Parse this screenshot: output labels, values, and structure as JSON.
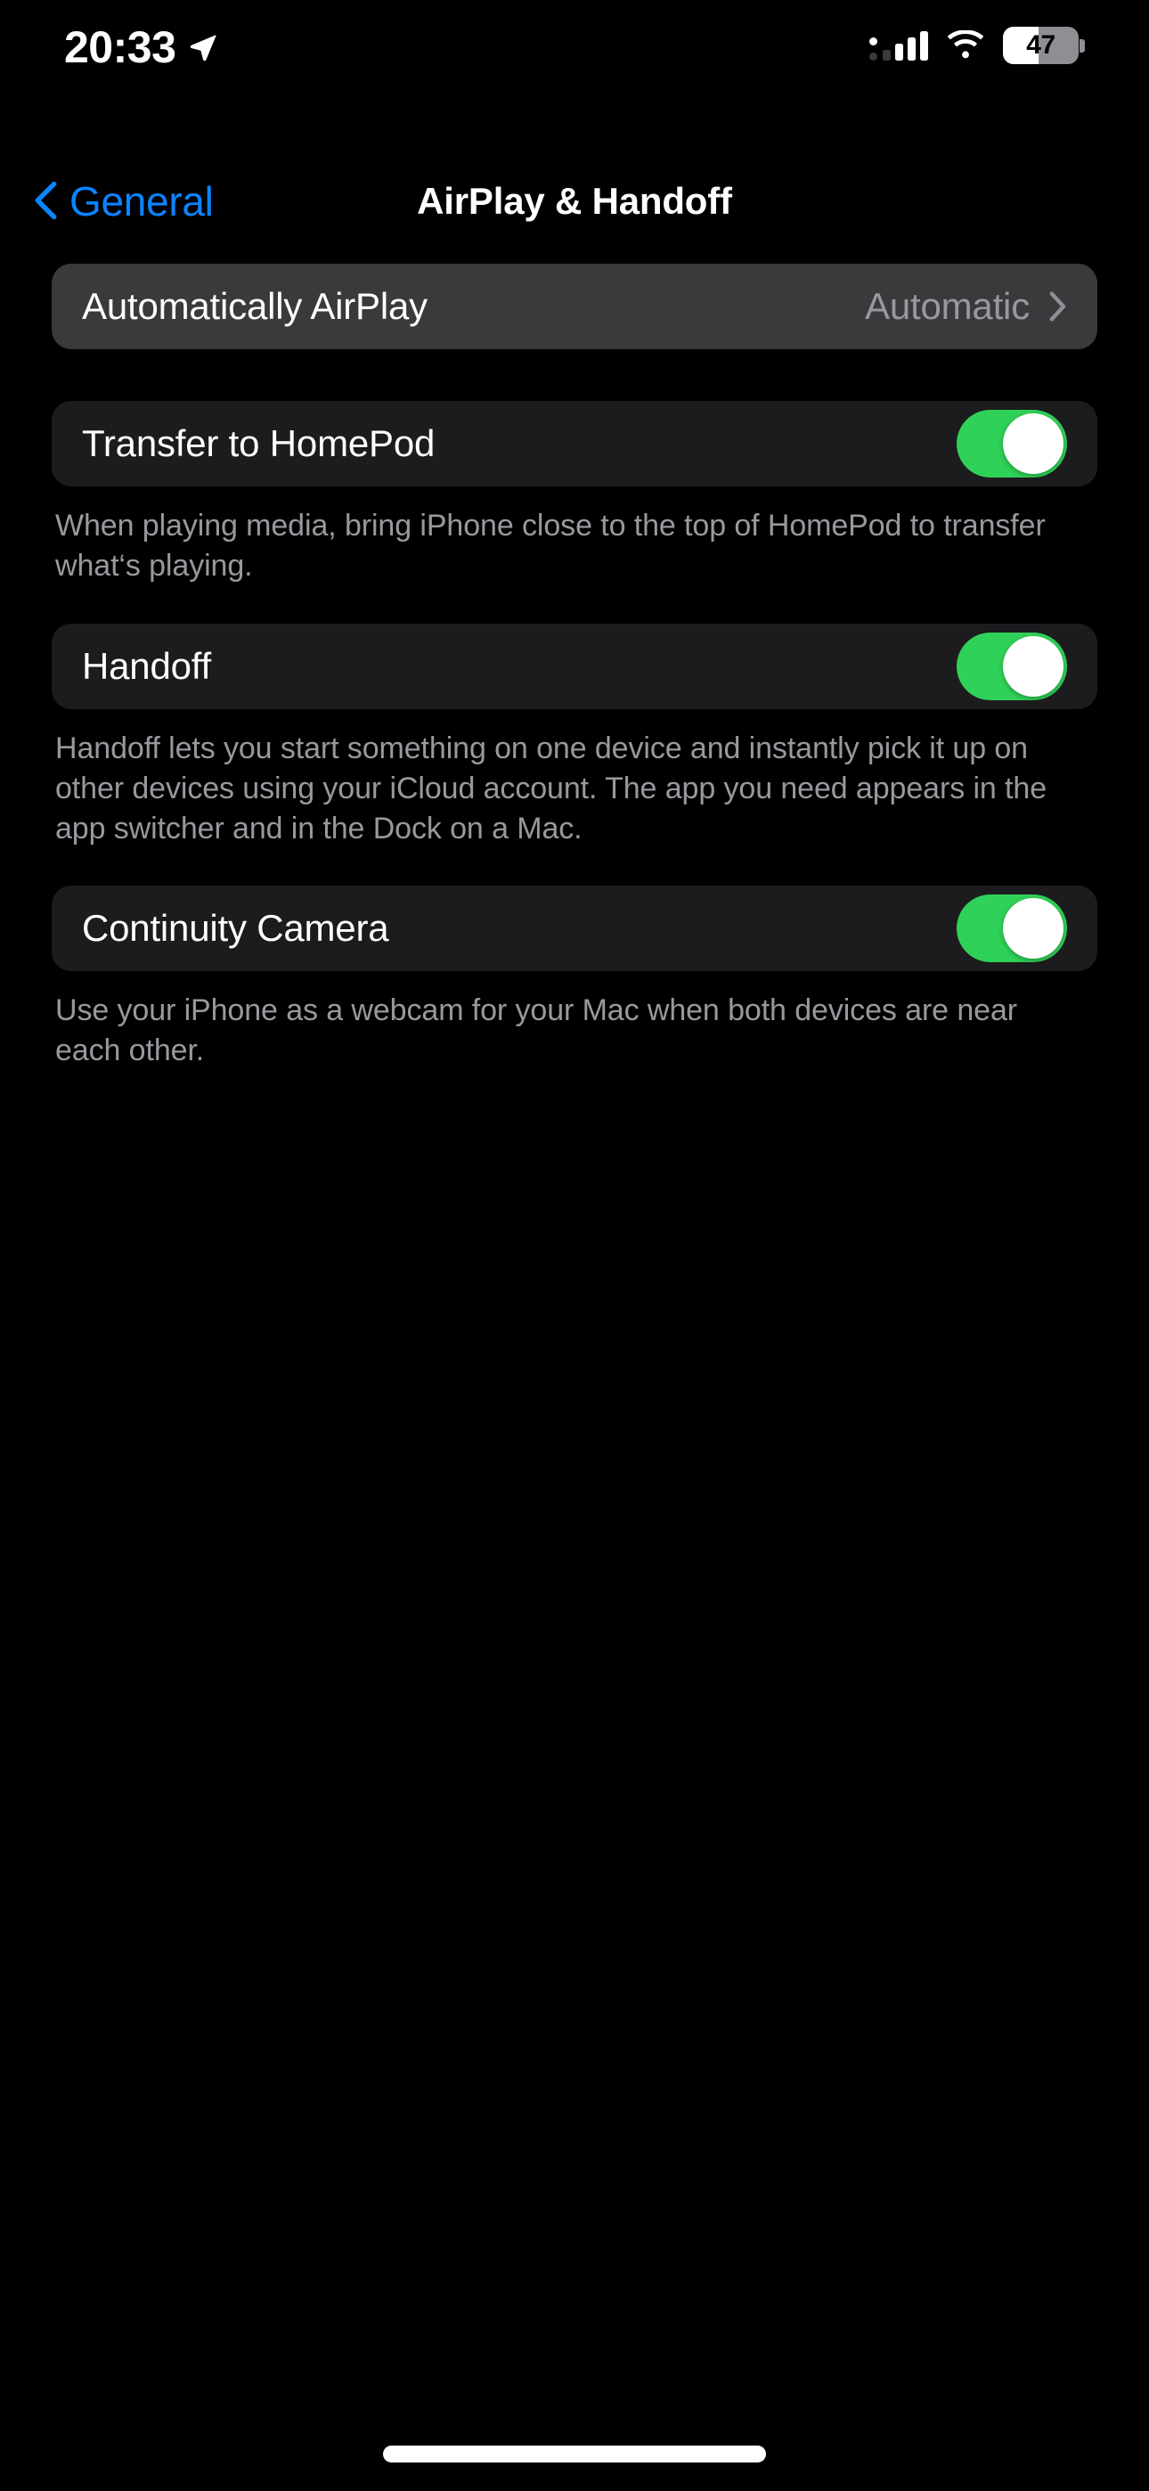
{
  "status_bar": {
    "time": "20:33",
    "location_icon": "location-arrow-icon",
    "cellular_icon": "cellular-signal-icon",
    "wifi_icon": "wifi-icon",
    "battery_percent": "47",
    "battery_level": 47
  },
  "nav": {
    "back_label": "General",
    "back_icon": "chevron-left-icon",
    "title": "AirPlay & Handoff"
  },
  "sections": [
    {
      "id": "automatically-airplay",
      "highlighted": true,
      "row": {
        "label": "Automatically AirPlay",
        "value": "Automatic",
        "accessory": "chevron-right-icon"
      },
      "footer": ""
    },
    {
      "id": "transfer-to-homepod",
      "highlighted": false,
      "row": {
        "label": "Transfer to HomePod",
        "toggle": true,
        "toggle_on": true
      },
      "footer": "When playing media, bring iPhone close to the top of HomePod to transfer what‘s playing."
    },
    {
      "id": "handoff",
      "highlighted": false,
      "row": {
        "label": "Handoff",
        "toggle": true,
        "toggle_on": true
      },
      "footer": "Handoff lets you start something on one device and instantly pick it up on other devices using your iCloud account. The app you need appears in the app switcher and in the Dock on a Mac."
    },
    {
      "id": "continuity-camera",
      "highlighted": false,
      "row": {
        "label": "Continuity Camera",
        "toggle": true,
        "toggle_on": true
      },
      "footer": "Use your iPhone as a webcam for your Mac when both devices are near each other."
    }
  ],
  "colors": {
    "background": "#000000",
    "card": "#1c1c1e",
    "card_highlighted": "#3a3a3c",
    "accent_blue": "#0a84ff",
    "toggle_green": "#30d158",
    "secondary_text": "#98989e"
  },
  "home_indicator": "home-indicator"
}
